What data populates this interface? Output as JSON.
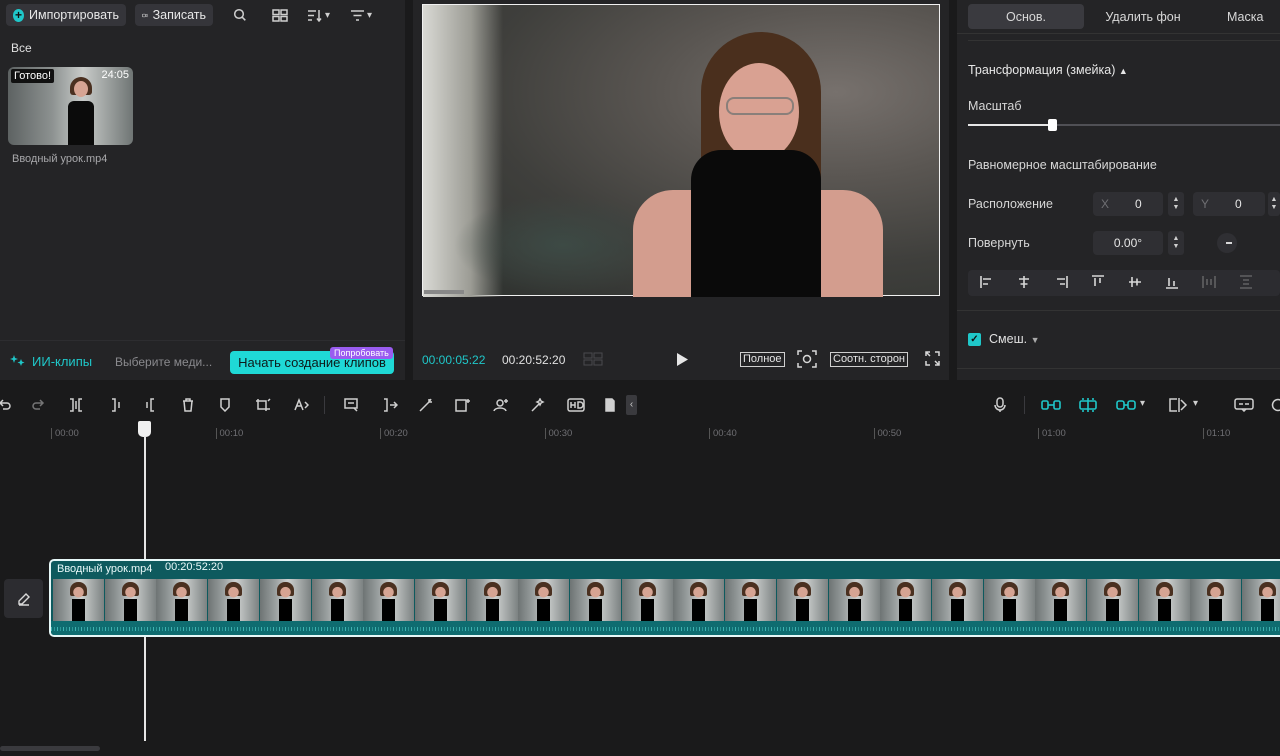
{
  "media": {
    "import_label": "Импортировать",
    "record_label": "Записать",
    "section_all": "Все",
    "item": {
      "badge": "Готово!",
      "duration": "24:05",
      "filename": "Вводный урок.mp4"
    },
    "ai_clips_label": "ИИ-клипы",
    "select_media_placeholder": "Выберите меди...",
    "start_clips_button": "Начать создание клипов",
    "try_badge": "Попробовать"
  },
  "preview": {
    "current_time": "00:00:05:22",
    "total_time": "00:20:52:20",
    "full_label": "Полное",
    "aspect_label": "Соотн. сторон"
  },
  "properties": {
    "tabs": [
      "Основ.",
      "Удалить фон",
      "Маска"
    ],
    "transform_title": "Трансформация (змейка)",
    "scale_label": "Масштаб",
    "scale_value": 0.2,
    "uniform_scale_label": "Равномерное масштабирование",
    "position_label": "Расположение",
    "x_label": "X",
    "x_value": "0",
    "y_label": "Y",
    "y_value": "0",
    "rotate_label": "Повернуть",
    "rotate_value": "0.00°",
    "blend_label": "Смеш.",
    "blend_checked": true
  },
  "timeline": {
    "ruler_ticks": [
      "00:00",
      "00:10",
      "00:20",
      "00:30",
      "00:40",
      "00:50",
      "01:00",
      "01:10"
    ],
    "clip_name": "Вводный урок.mp4",
    "clip_duration": "00:20:52:20"
  },
  "colors": {
    "accent": "#1fc7c9",
    "clip_bg": "#0e5a5e",
    "panel": "#242426",
    "badge_purple": "#9a5cf0"
  }
}
